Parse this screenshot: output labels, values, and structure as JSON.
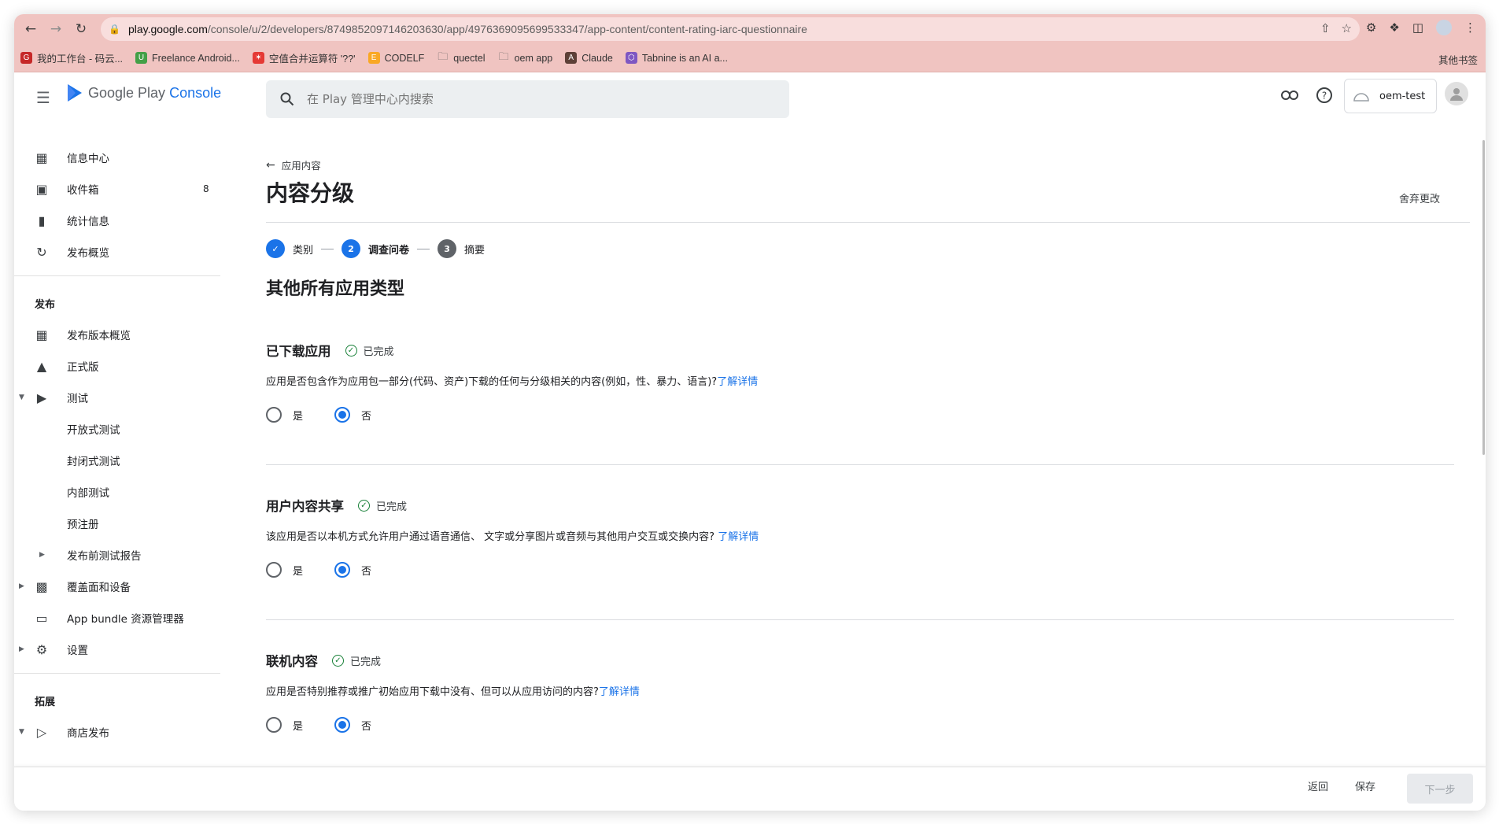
{
  "browser": {
    "url_host": "play.google.com",
    "url_path": "/console/u/2/developers/8749852097146203630/app/4976369095699533347/app-content/content-rating-iarc-questionnaire",
    "bookmarks": [
      {
        "label": "我的工作台 - 码云...",
        "color": "#c62828",
        "glyph": "G"
      },
      {
        "label": "Freelance Android...",
        "color": "#43a047",
        "glyph": "U"
      },
      {
        "label": "空值合并运算符 '??'",
        "color": "#e53935",
        "glyph": "✶"
      },
      {
        "label": "CODELF",
        "color": "#f9a825",
        "glyph": "E"
      },
      {
        "label": "quectel",
        "color": "",
        "glyph": "folder"
      },
      {
        "label": "oem app",
        "color": "",
        "glyph": "folder"
      },
      {
        "label": "Claude",
        "color": "#5d4037",
        "glyph": "A"
      },
      {
        "label": "Tabnine is an AI a...",
        "color": "#7e57c2",
        "glyph": "⬡"
      }
    ],
    "other_bookmarks": "其他书签"
  },
  "header": {
    "logo_text_1": "Google Play",
    "logo_text_2": "Console",
    "search_placeholder": "在 Play 管理中心内搜索",
    "account_name": "oem-test"
  },
  "sidebar": {
    "top_items": [
      {
        "label": "信息中心",
        "icon": "dashboard-icon"
      },
      {
        "label": "收件箱",
        "icon": "inbox-icon",
        "badge": "8"
      },
      {
        "label": "统计信息",
        "icon": "bar-chart-icon"
      },
      {
        "label": "发布概览",
        "icon": "publishing-overview-icon"
      }
    ],
    "release_section": "发布",
    "release_items": [
      {
        "label": "发布版本概览",
        "icon": "releases-icon"
      },
      {
        "label": "正式版",
        "icon": "production-icon"
      },
      {
        "label": "测试",
        "icon": "testing-icon"
      },
      {
        "label": "开放式测试"
      },
      {
        "label": "封闭式测试"
      },
      {
        "label": "内部测试"
      },
      {
        "label": "预注册"
      },
      {
        "label": "发布前测试报告"
      },
      {
        "label": "覆盖面和设备",
        "icon": "reach-devices-icon"
      },
      {
        "label": "App bundle 资源管理器",
        "icon": "app-bundle-icon"
      },
      {
        "label": "设置",
        "icon": "settings-icon"
      }
    ],
    "grow_section": "拓展",
    "grow_items": [
      {
        "label": "商店发布",
        "icon": "store-presence-icon"
      }
    ]
  },
  "main": {
    "back_label": "应用内容",
    "title": "内容分级",
    "discard": "舍弃更改",
    "steps": [
      {
        "num": "✓",
        "label": "类别"
      },
      {
        "num": "2",
        "label": "调查问卷"
      },
      {
        "num": "3",
        "label": "摘要"
      }
    ],
    "section_title": "其他所有应用类型",
    "questions": [
      {
        "title": "已下载应用",
        "status": "已完成",
        "text": "应用是否包含作为应用包一部分(代码、资产)下载的任何与分级相关的内容(例如，性、暴力、语言)?",
        "learn": "了解详情",
        "yes": "是",
        "no": "否",
        "selected": "no"
      },
      {
        "title": "用户内容共享",
        "status": "已完成",
        "text": "该应用是否以本机方式允许用户通过语音通信、 文字或分享图片或音频与其他用户交互或交换内容?",
        "learn": "了解详情",
        "yes": "是",
        "no": "否",
        "selected": "no"
      },
      {
        "title": "联机内容",
        "status": "已完成",
        "text": "应用是否特别推荐或推广初始应用下载中没有、但可以从应用访问的内容?",
        "learn": "了解详情",
        "yes": "是",
        "no": "否",
        "selected": "no"
      }
    ]
  },
  "footer": {
    "back": "返回",
    "save": "保存",
    "next": "下一步"
  },
  "colors": {
    "accent": "#1a73e8",
    "complete_green": "#188038",
    "browser_tint": "#f0c4c1"
  }
}
